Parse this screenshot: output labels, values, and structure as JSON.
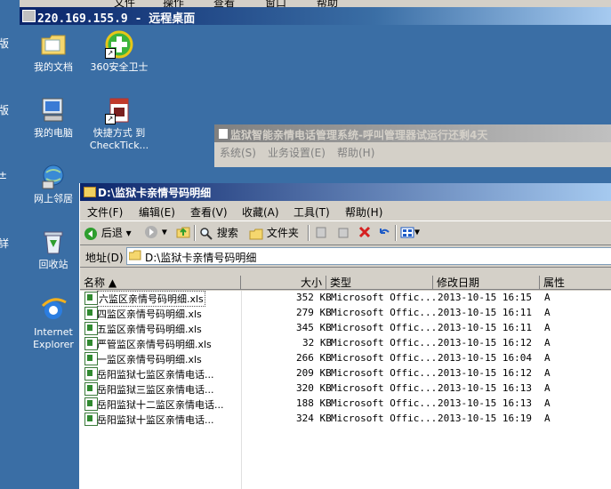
{
  "outer_menu": [
    "文件",
    "操作",
    "查看",
    "窗口",
    "帮助"
  ],
  "left_fragments": [
    "版",
    "版",
    "±",
    "詳"
  ],
  "rd_title": "220.169.155.9 - 远程桌面",
  "desktop_icons": [
    {
      "label": "我的文档"
    },
    {
      "label": "360安全卫士"
    },
    {
      "label": "我的电脑"
    },
    {
      "label": "快捷方式 到 CheckTick..."
    },
    {
      "label": "网上邻居"
    },
    {
      "label": "回收站"
    },
    {
      "label": "Internet Explorer"
    }
  ],
  "bg_window": {
    "title": "监狱智能亲情电话管理系统-呼叫管理器试运行还剩4天",
    "menu": [
      "系统(S)",
      "业务设置(E)",
      "帮助(H)"
    ]
  },
  "explorer": {
    "title": "D:\\监狱卡亲情号码明细",
    "menu": [
      "文件(F)",
      "编辑(E)",
      "查看(V)",
      "收藏(A)",
      "工具(T)",
      "帮助(H)"
    ],
    "toolbar": {
      "back": "后退",
      "search": "搜索",
      "folders": "文件夹"
    },
    "address_label": "地址(D)",
    "address_value": "D:\\监狱卡亲情号码明细",
    "columns": [
      "名称",
      "大小",
      "类型",
      "修改日期",
      "属性"
    ],
    "files": [
      {
        "name": "六监区亲情号码明细.xls",
        "size": "352 KB",
        "type": "Microsoft Offic...",
        "date": "2013-10-15 16:15",
        "attr": "A"
      },
      {
        "name": "四监区亲情号码明细.xls",
        "size": "279 KB",
        "type": "Microsoft Offic...",
        "date": "2013-10-15 16:11",
        "attr": "A"
      },
      {
        "name": "五监区亲情号码明细.xls",
        "size": "345 KB",
        "type": "Microsoft Offic...",
        "date": "2013-10-15 16:11",
        "attr": "A"
      },
      {
        "name": "严管监区亲情号码明细.xls",
        "size": "32 KB",
        "type": "Microsoft Offic...",
        "date": "2013-10-15 16:12",
        "attr": "A"
      },
      {
        "name": "一监区亲情号码明细.xls",
        "size": "266 KB",
        "type": "Microsoft Offic...",
        "date": "2013-10-15 16:04",
        "attr": "A"
      },
      {
        "name": "岳阳监狱七监区亲情电话...",
        "size": "209 KB",
        "type": "Microsoft Offic...",
        "date": "2013-10-15 16:12",
        "attr": "A"
      },
      {
        "name": "岳阳监狱三监区亲情电话...",
        "size": "320 KB",
        "type": "Microsoft Offic...",
        "date": "2013-10-15 16:13",
        "attr": "A"
      },
      {
        "name": "岳阳监狱十二监区亲情电话...",
        "size": "188 KB",
        "type": "Microsoft Offic...",
        "date": "2013-10-15 16:13",
        "attr": "A"
      },
      {
        "name": "岳阳监狱十监区亲情电话...",
        "size": "324 KB",
        "type": "Microsoft Offic...",
        "date": "2013-10-15 16:19",
        "attr": "A"
      }
    ]
  },
  "colors": {
    "title_active": "#0a246a",
    "desktop": "#3a6ea5",
    "face": "#d4d0c8"
  }
}
